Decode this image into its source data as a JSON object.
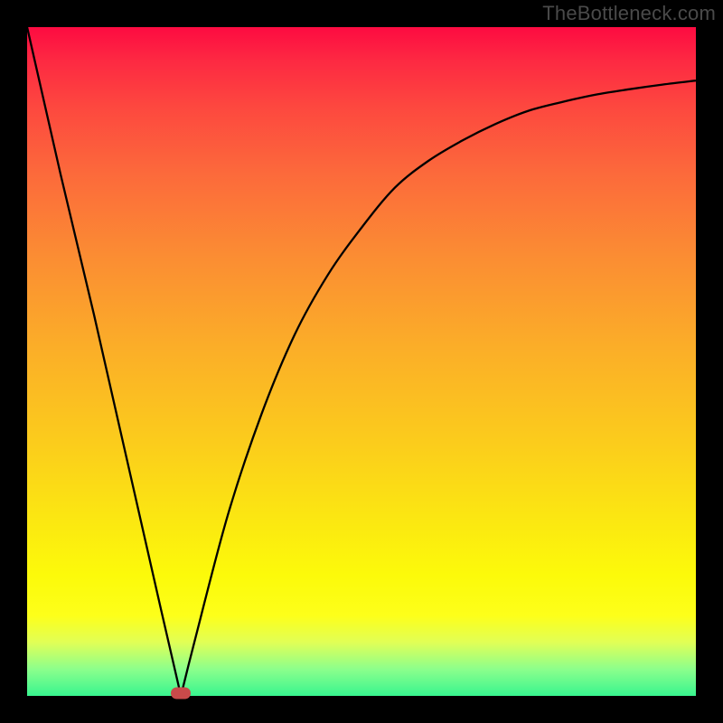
{
  "watermark": "TheBottleneck.com",
  "chart_data": {
    "type": "line",
    "title": "",
    "xlabel": "",
    "ylabel": "",
    "xlim": [
      0,
      100
    ],
    "ylim": [
      0,
      100
    ],
    "grid": false,
    "series": [
      {
        "name": "bottleneck-curve",
        "x": [
          0,
          5,
          10,
          15,
          20,
          23,
          25,
          30,
          35,
          40,
          45,
          50,
          55,
          60,
          65,
          70,
          75,
          80,
          85,
          90,
          95,
          100
        ],
        "values": [
          100,
          78,
          57,
          35,
          13,
          0,
          8,
          27,
          42,
          54,
          63,
          70,
          76,
          80,
          83,
          85.5,
          87.5,
          88.8,
          89.9,
          90.7,
          91.4,
          92
        ]
      }
    ],
    "marker": {
      "x": 23,
      "y": 0,
      "name": "optimal-point"
    },
    "gradient_colors": {
      "top": "#fd0b41",
      "mid_upper": "#fb8c33",
      "mid": "#fbe811",
      "mid_lower": "#fdff1a",
      "bottom": "#38f58f"
    }
  }
}
